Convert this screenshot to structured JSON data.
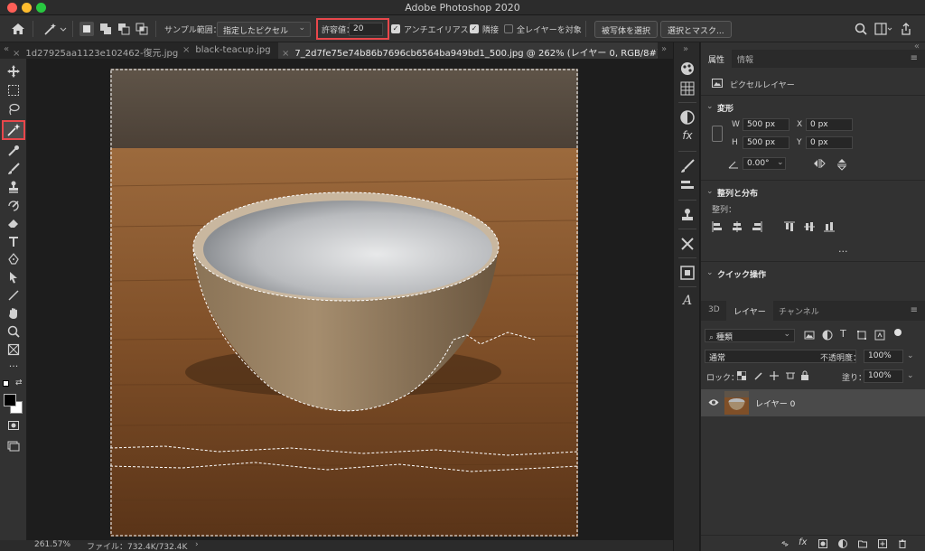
{
  "app": {
    "title": "Adobe Photoshop 2020"
  },
  "colors": {
    "highlight": "#e8474b",
    "accent": "#3b6fb6",
    "panel": "#323232",
    "canvas_bg": "#1d1d1d"
  },
  "options_bar": {
    "sample_size_label": "サンプル範囲：",
    "sample_size_value": "指定したピクセル",
    "tolerance_label": "許容値：",
    "tolerance_value": "20",
    "anti_alias_label": "アンチエイリアス",
    "anti_alias_checked": true,
    "contiguous_label": "隣接",
    "contiguous_checked": true,
    "all_layers_label": "全レイヤーを対象",
    "all_layers_checked": false,
    "select_subject_label": "被写体を選択",
    "select_mask_label": "選択とマスク..."
  },
  "tabs": [
    {
      "label": "1d27925aa1123e102462-復元.jpg",
      "active": false
    },
    {
      "label": "black-teacup.jpg",
      "active": false
    },
    {
      "label": "7_2d7fe75e74b86b7696cb6564ba949bd1_500.jpg @ 262% (レイヤー 0, RGB/8#) *",
      "active": true
    }
  ],
  "status": {
    "zoom": "261.57%",
    "file": "ファイル：732.4K/732.4K"
  },
  "properties": {
    "tabs": [
      "属性",
      "情報"
    ],
    "layer_type": "ピクセルレイヤー",
    "transform_heading": "変形",
    "w_label": "W",
    "w_value": "500 px",
    "h_label": "H",
    "h_value": "500 px",
    "x_label": "X",
    "x_value": "0 px",
    "y_label": "Y",
    "y_value": "0 px",
    "angle_value": "0.00°",
    "align_heading": "整列と分布",
    "align_sub": "整列：",
    "more": "...",
    "quick_heading": "クイック操作"
  },
  "layers": {
    "tabs": [
      "3D",
      "レイヤー",
      "チャンネル"
    ],
    "filter_kind": "種類",
    "blend_mode": "通常",
    "opacity_label": "不透明度：",
    "opacity_value": "100%",
    "lock_label": "ロック：",
    "fill_label": "塗り：",
    "fill_value": "100%",
    "items": [
      {
        "name": "レイヤー 0",
        "visible": true
      }
    ]
  }
}
